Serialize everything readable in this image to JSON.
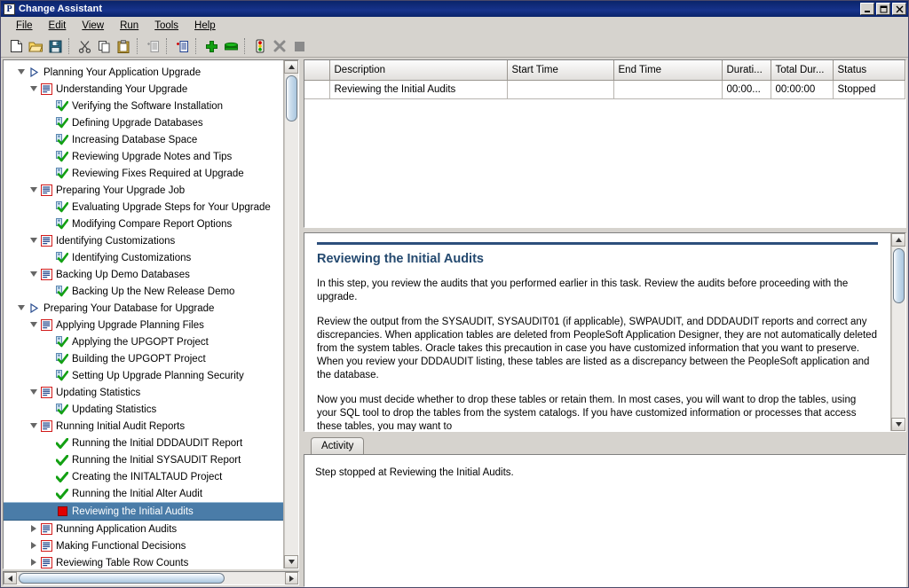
{
  "window": {
    "title": "Change Assistant",
    "icon": "peoplesoft-logo-icon",
    "minimize_label": "Minimize",
    "maximize_label": "Maximize",
    "close_label": "Close"
  },
  "menu": {
    "items": [
      {
        "label": "File",
        "mnemonic": "F"
      },
      {
        "label": "Edit",
        "mnemonic": "E"
      },
      {
        "label": "View",
        "mnemonic": "V"
      },
      {
        "label": "Run",
        "mnemonic": "R"
      },
      {
        "label": "Tools",
        "mnemonic": "T"
      },
      {
        "label": "Help",
        "mnemonic": "H"
      }
    ]
  },
  "toolbar": {
    "buttons": [
      {
        "name": "new-icon",
        "label": "New"
      },
      {
        "name": "open-folder-icon",
        "label": "Open"
      },
      {
        "name": "save-icon",
        "label": "Save"
      },
      {
        "name": "cut-scissors-icon",
        "label": "Cut"
      },
      {
        "name": "copy-icon",
        "label": "Copy"
      },
      {
        "name": "paste-clipboard-icon",
        "label": "Paste"
      },
      {
        "name": "insert-step-disabled-icon",
        "label": "Insert Step"
      },
      {
        "name": "insert-task-icon",
        "label": "Insert Task"
      },
      {
        "name": "add-plus-icon",
        "label": "Add"
      },
      {
        "name": "database-icon",
        "label": "Database"
      },
      {
        "name": "traffic-light-run-icon",
        "label": "Run"
      },
      {
        "name": "stop-x-icon",
        "label": "Cancel"
      },
      {
        "name": "stop-square-icon",
        "label": "Stop"
      }
    ]
  },
  "tree": {
    "nodes": [
      {
        "label": "Planning Your Application Upgrade",
        "depth": 0,
        "twist": "open",
        "icon": "chapter-icon",
        "selected": false
      },
      {
        "label": "Understanding Your Upgrade",
        "depth": 1,
        "twist": "open",
        "icon": "task-icon",
        "selected": false
      },
      {
        "label": "Verifying the Software Installation",
        "depth": 2,
        "twist": "none",
        "icon": "step-done-icon",
        "selected": false
      },
      {
        "label": "Defining Upgrade Databases",
        "depth": 2,
        "twist": "none",
        "icon": "step-done-icon",
        "selected": false
      },
      {
        "label": "Increasing Database Space",
        "depth": 2,
        "twist": "none",
        "icon": "step-done-icon",
        "selected": false
      },
      {
        "label": "Reviewing Upgrade Notes and Tips",
        "depth": 2,
        "twist": "none",
        "icon": "step-done-icon",
        "selected": false
      },
      {
        "label": "Reviewing Fixes Required at Upgrade",
        "depth": 2,
        "twist": "none",
        "icon": "step-done-icon",
        "selected": false
      },
      {
        "label": "Preparing Your Upgrade Job",
        "depth": 1,
        "twist": "open",
        "icon": "task-icon",
        "selected": false
      },
      {
        "label": "Evaluating Upgrade Steps for Your Upgrade",
        "depth": 2,
        "twist": "none",
        "icon": "step-done-icon",
        "selected": false
      },
      {
        "label": "Modifying Compare Report Options",
        "depth": 2,
        "twist": "none",
        "icon": "step-done-icon",
        "selected": false
      },
      {
        "label": "Identifying Customizations",
        "depth": 1,
        "twist": "open",
        "icon": "task-icon",
        "selected": false
      },
      {
        "label": "Identifying Customizations",
        "depth": 2,
        "twist": "none",
        "icon": "step-done-icon",
        "selected": false
      },
      {
        "label": "Backing Up Demo Databases",
        "depth": 1,
        "twist": "open",
        "icon": "task-icon",
        "selected": false
      },
      {
        "label": "Backing Up the New Release Demo",
        "depth": 2,
        "twist": "none",
        "icon": "step-done-icon",
        "selected": false
      },
      {
        "label": "Preparing Your Database for Upgrade",
        "depth": 0,
        "twist": "open",
        "icon": "chapter-icon",
        "selected": false
      },
      {
        "label": "Applying Upgrade Planning Files",
        "depth": 1,
        "twist": "open",
        "icon": "task-icon",
        "selected": false
      },
      {
        "label": "Applying the UPGOPT Project",
        "depth": 2,
        "twist": "none",
        "icon": "step-done-icon",
        "selected": false
      },
      {
        "label": "Building the UPGOPT Project",
        "depth": 2,
        "twist": "none",
        "icon": "step-done-icon",
        "selected": false
      },
      {
        "label": "Setting Up Upgrade Planning Security",
        "depth": 2,
        "twist": "none",
        "icon": "step-done-icon",
        "selected": false
      },
      {
        "label": "Updating Statistics",
        "depth": 1,
        "twist": "open",
        "icon": "task-icon",
        "selected": false
      },
      {
        "label": "Updating Statistics",
        "depth": 2,
        "twist": "none",
        "icon": "step-done-icon",
        "selected": false
      },
      {
        "label": "Running Initial Audit Reports",
        "depth": 1,
        "twist": "open",
        "icon": "task-icon",
        "selected": false
      },
      {
        "label": "Running the Initial DDDAUDIT Report",
        "depth": 2,
        "twist": "none",
        "icon": "check-complete-icon",
        "selected": false
      },
      {
        "label": "Running the Initial SYSAUDIT Report",
        "depth": 2,
        "twist": "none",
        "icon": "check-complete-icon",
        "selected": false
      },
      {
        "label": "Creating the INITALTAUD Project",
        "depth": 2,
        "twist": "none",
        "icon": "check-complete-icon",
        "selected": false
      },
      {
        "label": "Running the Initial Alter Audit",
        "depth": 2,
        "twist": "none",
        "icon": "check-complete-icon",
        "selected": false
      },
      {
        "label": "Reviewing the Initial Audits",
        "depth": 2,
        "twist": "none",
        "icon": "stop-red-square-icon",
        "selected": true
      },
      {
        "label": "Running Application Audits",
        "depth": 1,
        "twist": "closed",
        "icon": "task-icon",
        "selected": false
      },
      {
        "label": "Making Functional Decisions",
        "depth": 1,
        "twist": "closed",
        "icon": "task-icon",
        "selected": false
      },
      {
        "label": "Reviewing Table Row Counts",
        "depth": 1,
        "twist": "closed",
        "icon": "task-icon",
        "selected": false
      }
    ]
  },
  "grid": {
    "columns": [
      "",
      "Description",
      "Start Time",
      "End Time",
      "Durati...",
      "Total Dur...",
      "Status"
    ],
    "rows": [
      {
        "cells": [
          "",
          "Reviewing the Initial Audits",
          "",
          "",
          "00:00...",
          "00:00:00",
          "Stopped"
        ]
      }
    ]
  },
  "document": {
    "heading": "Reviewing the Initial Audits",
    "paragraphs": [
      "In this step, you review the audits that you performed earlier in this task. Review the audits before proceeding with the upgrade.",
      "Review the output from the SYSAUDIT, SYSAUDIT01 (if applicable), SWPAUDIT, and DDDAUDIT reports and correct any discrepancies. When application tables are deleted from PeopleSoft Application Designer, they are not automatically deleted from the system tables. Oracle takes this precaution in case you have customized information that you want to preserve. When you review your DDDAUDIT listing, these tables are listed as a discrepancy between the PeopleSoft application and the database.",
      "Now you must decide whether to drop these tables or retain them. In most cases, you will want to drop the tables, using your SQL tool to drop the tables from the system catalogs. If you have customized information or processes that access these tables, you may want to"
    ]
  },
  "tabs": {
    "items": [
      {
        "label": "Activity",
        "active": true
      }
    ]
  },
  "activity": {
    "message": "Step stopped at Reviewing the Initial Audits."
  },
  "colors": {
    "titlebar": "#0a246a",
    "selection": "#4a7ca8",
    "doc_heading": "#24496f",
    "doc_rule": "#2d4f7c",
    "status_stopped": "#000000",
    "step_done_check": "#13a013",
    "stop_marker": "#e00000",
    "window_face": "#d6d3ce"
  }
}
